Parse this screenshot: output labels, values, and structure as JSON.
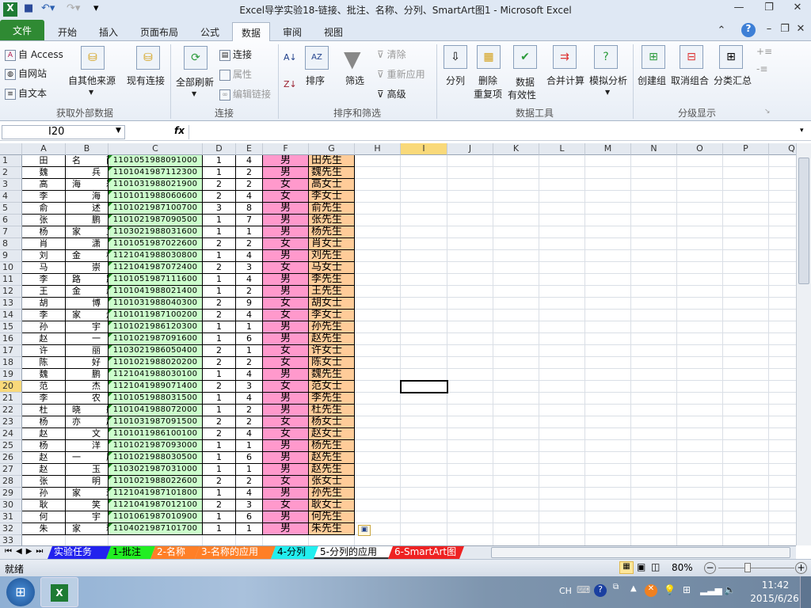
{
  "window": {
    "title": "Excel导学实验18-链接、批注、名称、分列、SmartArt图1  -  Microsoft Excel"
  },
  "tabs": [
    "文件",
    "开始",
    "插入",
    "页面布局",
    "公式",
    "数据",
    "审阅",
    "视图"
  ],
  "active_tab": "数据",
  "ribbon": {
    "get_external": {
      "access": "自 Access",
      "web": "自网站",
      "text": "自文本",
      "other": "自其他来源",
      "existing": "现有连接",
      "group": "获取外部数据"
    },
    "connections": {
      "refresh_all": "全部刷新",
      "connections": "连接",
      "properties": "属性",
      "edit_links": "编辑链接",
      "group": "连接"
    },
    "sort_filter": {
      "sort": "排序",
      "filter": "筛选",
      "clear": "清除",
      "reapply": "重新应用",
      "advanced": "高级",
      "group": "排序和筛选"
    },
    "data_tools": {
      "text_to_columns": "分列",
      "remove_dup_1": "删除",
      "remove_dup_2": "重复项",
      "validation_1": "数据",
      "validation_2": "有效性",
      "consolidate": "合并计算",
      "what_if": "模拟分析",
      "group": "数据工具"
    },
    "outline": {
      "group_btn": "创建组",
      "ungroup": "取消组合",
      "subtotal": "分类汇总",
      "group": "分级显示"
    }
  },
  "formula_bar": {
    "name_box": "I20",
    "fx": "fx",
    "formula": ""
  },
  "columns": [
    "A",
    "B",
    "C",
    "D",
    "E",
    "F",
    "G",
    "H",
    "I",
    "J",
    "K",
    "L",
    "M",
    "N",
    "O",
    "P",
    "Q"
  ],
  "selected_cell": "I20",
  "rows": [
    [
      "田",
      "名雨",
      "1101051988091000",
      "1",
      "4",
      "男",
      "田先生"
    ],
    [
      "魏",
      "兵",
      "1101041987112300",
      "1",
      "2",
      "男",
      "魏先生"
    ],
    [
      "高",
      "海岩",
      "1101031988021900",
      "2",
      "2",
      "女",
      "高女士"
    ],
    [
      "李",
      "海",
      "1101011988060600",
      "2",
      "4",
      "女",
      "李女士"
    ],
    [
      "俞",
      "述",
      "1101021987100700",
      "3",
      "8",
      "男",
      "俞先生"
    ],
    [
      "张",
      "鹏",
      "1101021987090500",
      "1",
      "7",
      "男",
      "张先生"
    ],
    [
      "杨",
      "家直",
      "1103021988031600",
      "1",
      "1",
      "男",
      "杨先生"
    ],
    [
      "肖",
      "潇",
      "1101051987022600",
      "2",
      "2",
      "女",
      "肖女士"
    ],
    [
      "刘",
      "金杨",
      "1121041988030800",
      "1",
      "4",
      "男",
      "刘先生"
    ],
    [
      "马",
      "崇",
      "1121041987072400",
      "2",
      "3",
      "女",
      "马女士"
    ],
    [
      "李",
      "路路",
      "1101051987111600",
      "1",
      "4",
      "男",
      "李先生"
    ],
    [
      "王",
      "金磊",
      "1101041988021400",
      "1",
      "2",
      "男",
      "王先生"
    ],
    [
      "胡",
      "博",
      "1101031988040300",
      "2",
      "9",
      "女",
      "胡女士"
    ],
    [
      "李",
      "家烨",
      "1101011987100200",
      "2",
      "4",
      "女",
      "李女士"
    ],
    [
      "孙",
      "宇",
      "1101021986120300",
      "1",
      "1",
      "男",
      "孙先生"
    ],
    [
      "赵",
      "一",
      "1101021987091600",
      "1",
      "6",
      "男",
      "赵先生"
    ],
    [
      "许",
      "丽",
      "1103021986050400",
      "2",
      "1",
      "女",
      "许女士"
    ],
    [
      "陈",
      "好",
      "1101021988020200",
      "2",
      "2",
      "女",
      "陈女士"
    ],
    [
      "魏",
      "鹏",
      "1121041988030100",
      "1",
      "4",
      "男",
      "魏先生"
    ],
    [
      "范",
      "杰",
      "1121041989071400",
      "2",
      "3",
      "女",
      "范女士"
    ],
    [
      "李",
      "农",
      "1101051988031500",
      "1",
      "4",
      "男",
      "李先生"
    ],
    [
      "杜",
      "晓航",
      "1101041988072000",
      "1",
      "2",
      "男",
      "杜先生"
    ],
    [
      "杨",
      "亦超",
      "1101031987091500",
      "2",
      "2",
      "女",
      "杨女士"
    ],
    [
      "赵",
      "文",
      "1101011986100100",
      "2",
      "4",
      "女",
      "赵女士"
    ],
    [
      "杨",
      "洋",
      "1101021987093000",
      "1",
      "1",
      "男",
      "杨先生"
    ],
    [
      "赵",
      "一原",
      "1101021988030500",
      "1",
      "6",
      "男",
      "赵先生"
    ],
    [
      "赵",
      "玉",
      "1103021987031000",
      "1",
      "1",
      "男",
      "赵先生"
    ],
    [
      "张",
      "明",
      "1101021988022600",
      "2",
      "2",
      "女",
      "张女士"
    ],
    [
      "孙",
      "家琪",
      "1121041987101800",
      "1",
      "4",
      "男",
      "孙先生"
    ],
    [
      "耿",
      "笑",
      "1121041987012100",
      "2",
      "3",
      "女",
      "耿女士"
    ],
    [
      "何",
      "宇",
      "1101061987010900",
      "1",
      "6",
      "男",
      "何先生"
    ],
    [
      "朱",
      "家琳",
      "1104021987101700",
      "1",
      "1",
      "男",
      "朱先生"
    ]
  ],
  "sheets": [
    {
      "name": "实验任务",
      "color": "#2222ee",
      "fg": "#ffffff"
    },
    {
      "name": "1-批注",
      "color": "#22ee22",
      "fg": "#000000"
    },
    {
      "name": "2-名称",
      "color": "#ff7f27",
      "fg": "#ffffff"
    },
    {
      "name": "3-名称的应用",
      "color": "#ff7f27",
      "fg": "#ffffff"
    },
    {
      "name": "4-分列",
      "color": "#22eeee",
      "fg": "#000000"
    },
    {
      "name": "5-分列的应用",
      "color": "#ffffff",
      "fg": "#000000"
    },
    {
      "name": "6-SmartArt图",
      "color": "#ee2222",
      "fg": "#ffffff"
    }
  ],
  "status": {
    "ready": "就绪",
    "zoom": "80%"
  },
  "taskbar": {
    "lang": "CH",
    "time": "11:42",
    "date": "2015/6/26"
  }
}
